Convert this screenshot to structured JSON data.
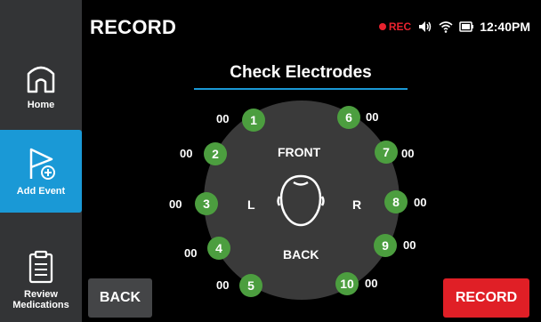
{
  "header": {
    "title": "RECORD",
    "rec_label": "REC",
    "time": "12:40PM"
  },
  "sidebar": {
    "items": [
      {
        "label": "Home",
        "icon": "home-icon",
        "active": false
      },
      {
        "label": "Add Event",
        "icon": "flag-add-icon",
        "active": true
      },
      {
        "label": "Review Medications",
        "icon": "clipboard-icon",
        "active": false
      }
    ]
  },
  "main": {
    "heading": "Check Electrodes",
    "labels": {
      "front": "FRONT",
      "back": "BACK",
      "left": "L",
      "right": "R"
    },
    "electrodes": [
      {
        "number": "1",
        "reading": "00"
      },
      {
        "number": "2",
        "reading": "00"
      },
      {
        "number": "3",
        "reading": "00"
      },
      {
        "number": "4",
        "reading": "00"
      },
      {
        "number": "5",
        "reading": "00"
      },
      {
        "number": "6",
        "reading": "00"
      },
      {
        "number": "7",
        "reading": "00"
      },
      {
        "number": "8",
        "reading": "00"
      },
      {
        "number": "9",
        "reading": "00"
      },
      {
        "number": "10",
        "reading": "00"
      }
    ]
  },
  "footer": {
    "back_label": "BACK",
    "record_label": "RECORD"
  },
  "colors": {
    "accent": "#1a99d6",
    "electrode": "#4c9e3f",
    "record": "#e01f26",
    "sidebar": "#333436"
  }
}
